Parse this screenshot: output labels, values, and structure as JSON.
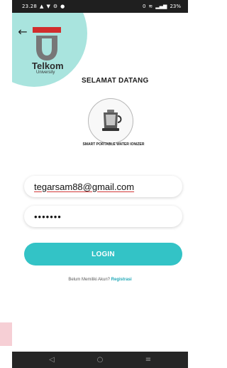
{
  "status_bar": {
    "time": "23.28",
    "left_icons": [
      "signal-icon",
      "notification-icon",
      "settings-icon",
      "app-icon"
    ],
    "right_text": "0 ",
    "right_icons": [
      "wifi-icon",
      "cell-signal-icon",
      "battery-icon"
    ],
    "battery": "23%"
  },
  "header": {
    "back_icon": "arrow-left-icon"
  },
  "logo": {
    "name": "Telkom",
    "sub": "University",
    "accent_color": "#d12d2d"
  },
  "welcome_title": "SELAMAT DATANG",
  "device": {
    "icon": "water-ionizer-device-icon",
    "caption": "SMART PORTABLE WATER IONIZER"
  },
  "form": {
    "email_value": "tegarsam88@gmail.com",
    "password_value": "•••••••",
    "login_label": "LOGIN"
  },
  "register": {
    "prompt": "Belum Memiliki Akun?",
    "link": "Registrasi"
  },
  "navigation_bar": {
    "back_icon": "nav-back-icon",
    "home_icon": "nav-home-icon",
    "recents_icon": "nav-recents-icon"
  },
  "colors": {
    "teal": "#33c3c6",
    "mint": "#a9e4de",
    "dark": "#1f1f1f"
  }
}
